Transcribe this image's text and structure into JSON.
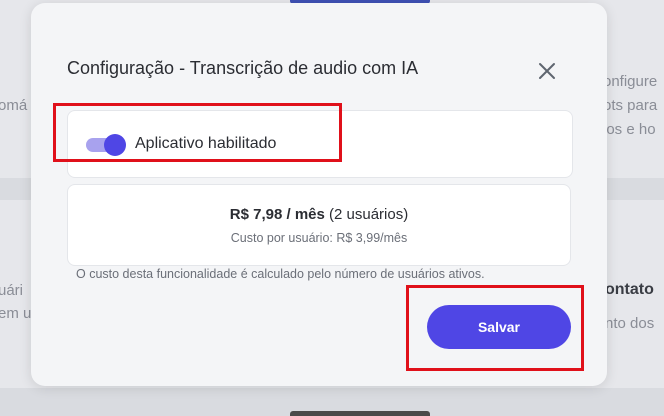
{
  "background": {
    "texts": [
      "omá",
      "onfigure",
      "ots para",
      "ios e ho",
      "uári",
      "em u",
      "ontato",
      "nto dos"
    ]
  },
  "modal": {
    "title": "Configuração - Transcrição de audio com IA",
    "close_icon": "close-icon",
    "toggle": {
      "label": "Aplicativo habilitado",
      "enabled": true,
      "accent_color": "#4f46e5"
    },
    "pricing": {
      "price": "R$ 7,98 / mês",
      "users": "(2 usuários)",
      "per_user": "Custo por usuário: R$ 3,99/mês"
    },
    "note": "O custo desta funcionalidade é calculado pelo número de usuários ativos.",
    "save_label": "Salvar"
  },
  "colors": {
    "highlight": "#e0101a",
    "primary": "#4f46e5"
  }
}
